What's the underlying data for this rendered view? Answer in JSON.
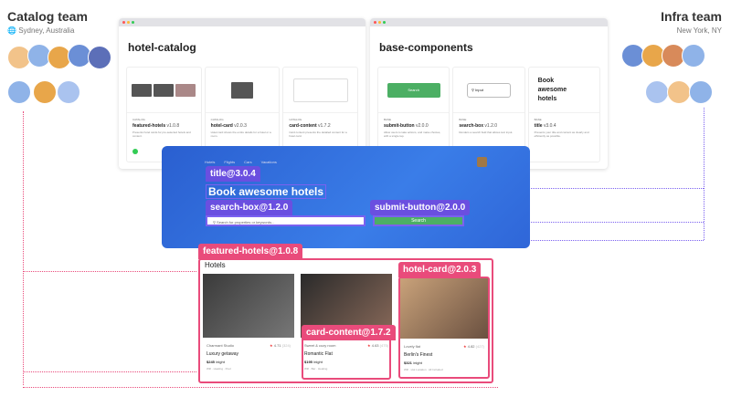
{
  "left_team": {
    "name": "Catalog team",
    "location": "Sydney, Australia"
  },
  "right_team": {
    "name": "Infra team",
    "location": "New York, NY"
  },
  "catalog_window": {
    "title": "hotel-catalog",
    "cards": [
      {
        "category": "CATALOG",
        "name": "featured-hotels",
        "version": "v1.0.8",
        "desc": "Presents hotel cards for pre-selected hotels and content."
      },
      {
        "category": "CATALOG",
        "name": "hotel-card",
        "version": "v2.0.3",
        "desc": "Hotel card shows the entire details for a hotel or a room."
      },
      {
        "category": "CATALOG",
        "name": "card-content",
        "version": "v1.7.2",
        "desc": "Card content presents the detailed content for a hotel card."
      }
    ]
  },
  "base_window": {
    "title": "base-components",
    "search_label": "Search",
    "input_label": "Input",
    "title_preview": "Book awesome hotels",
    "cards": [
      {
        "category": "BASE",
        "name": "submit-button",
        "version": "v2.0.0",
        "desc": "Allow users to take actions, and make choices, with a single tap."
      },
      {
        "category": "BASE",
        "name": "search-box",
        "version": "v1.2.0",
        "desc": "Renders a search field that allows text input."
      },
      {
        "category": "BASE",
        "name": "title",
        "version": "v3.0.4",
        "desc": "Presents your title and content as clearly and efficiently as possible."
      }
    ]
  },
  "banner": {
    "nav": [
      "Hotels",
      "Flights",
      "Cars",
      "Vacations"
    ],
    "title": "Book awesome hotels",
    "search_placeholder": "Search for properties or keywords...",
    "search_button": "Search"
  },
  "tags": {
    "title": "title@3.0.4",
    "search_box": "search-box@1.2.0",
    "submit_button": "submit-button@2.0.0",
    "featured_hotels": "featured-hotels@1.0.8",
    "hotel_card": "hotel-card@2.0.3",
    "card_content": "card-content@1.7.2"
  },
  "hotels": {
    "heading": "Hotels",
    "items": [
      {
        "type": "Charmant Studio",
        "rating": "4.71",
        "reviews": "(324)",
        "name": "Luxury getaway",
        "price": "$245",
        "per": "/night",
        "amenities": "Wifi · Heating · Pool"
      },
      {
        "type": "Sweet & cozy room",
        "rating": "4.63",
        "reviews": "(475)",
        "name": "Romantic  Flat",
        "price": "$195",
        "per": "/night",
        "amenities": "Wifi · Bar · Heating"
      },
      {
        "type": "Lovely flat",
        "rating": "4.82",
        "reviews": "(427)",
        "name": "Berlin's Finest",
        "price": "$321",
        "per": "/night",
        "amenities": "Wifi · Hot Location · All Included"
      }
    ]
  },
  "colors": {
    "purple": "#6a4fe0",
    "pink": "#e94b7b",
    "green": "#4caf64",
    "blue": "#2f66d8"
  }
}
